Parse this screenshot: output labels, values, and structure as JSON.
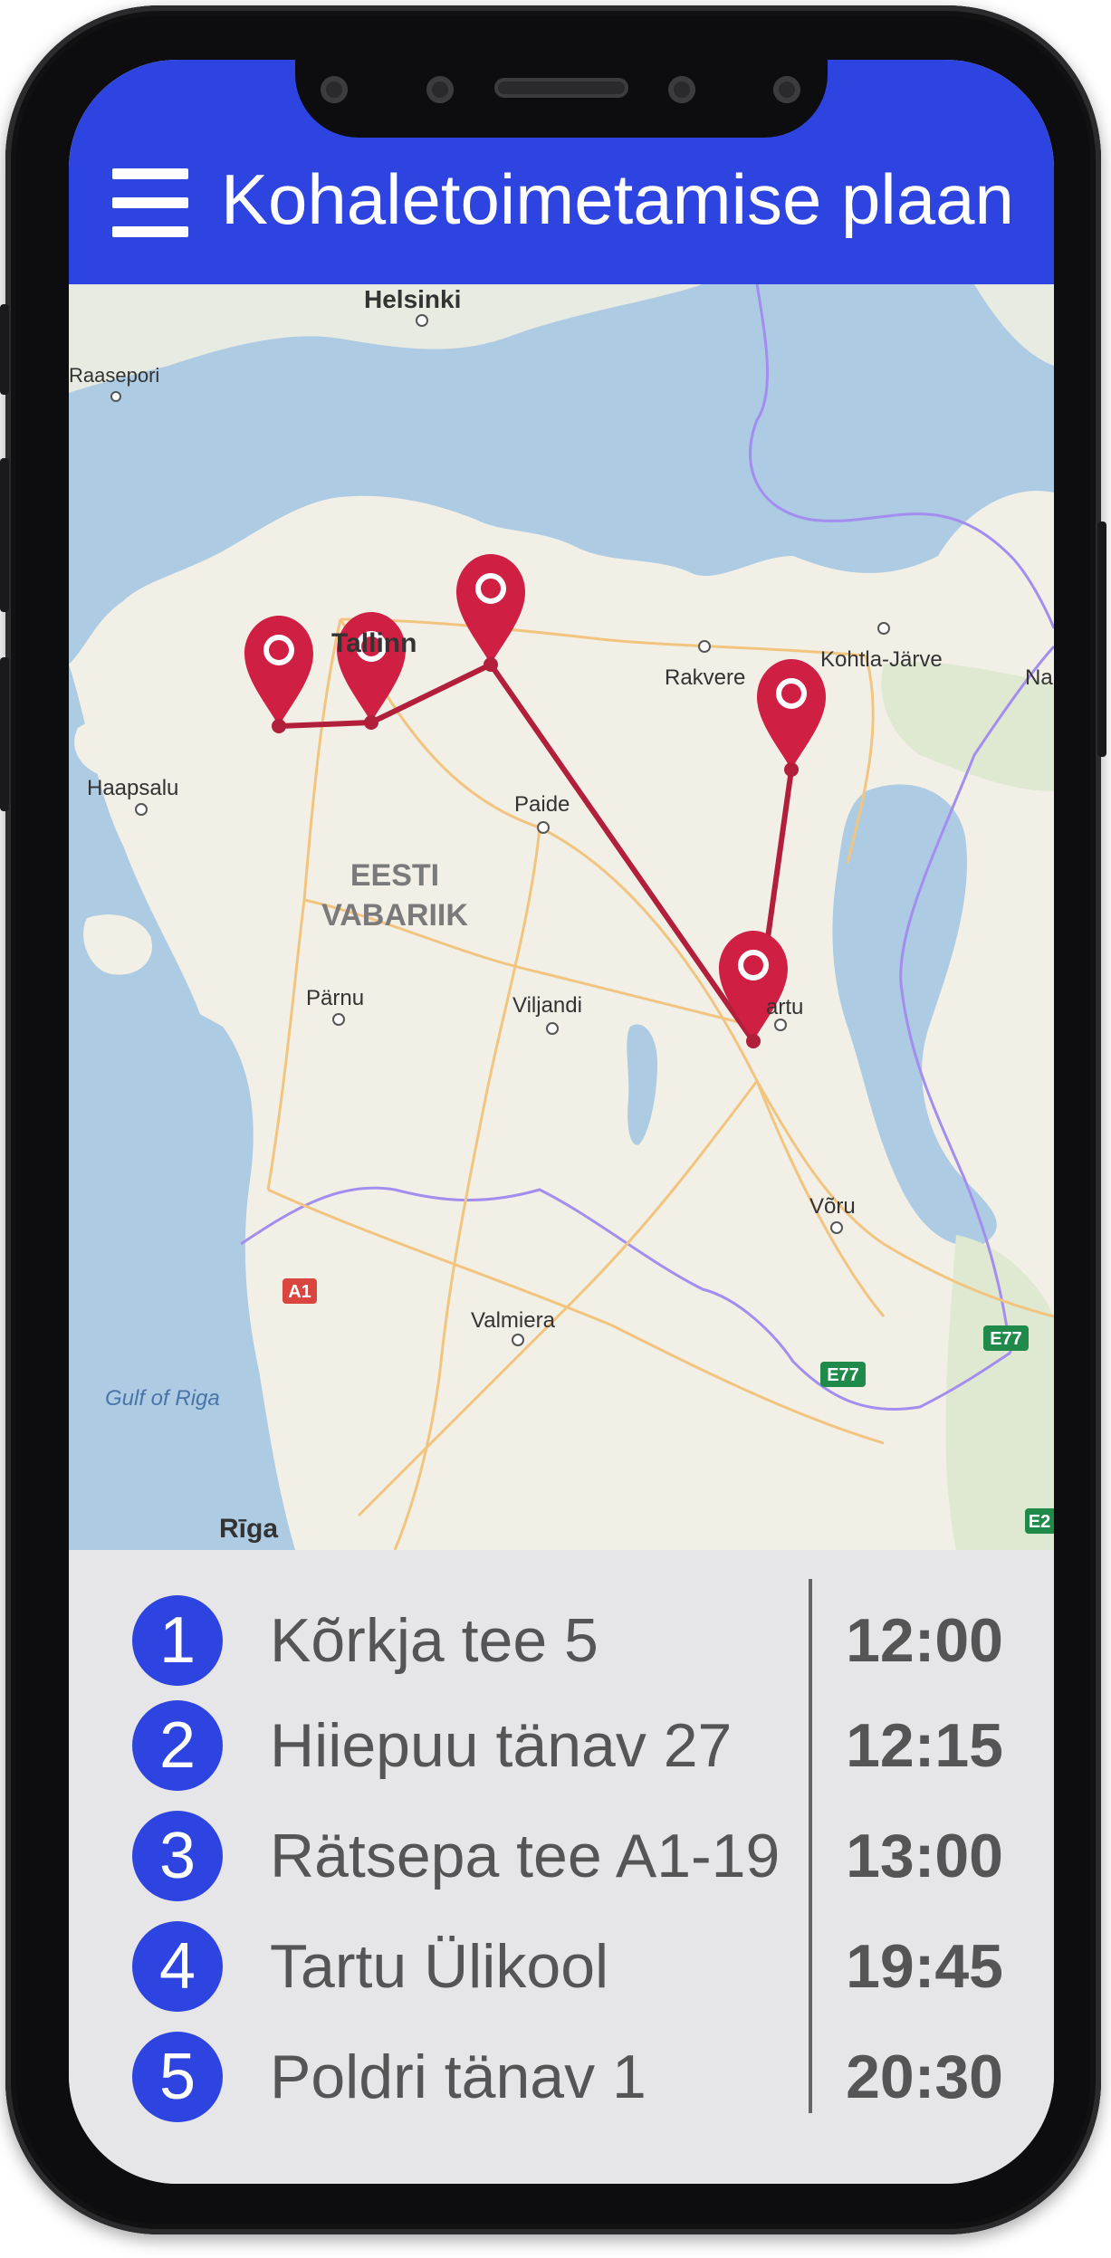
{
  "header": {
    "title": "Kohaletoimetamise plaan",
    "menu_icon": "hamburger-menu-icon",
    "color": "#2d44e0"
  },
  "map": {
    "country_label": [
      "EESTI",
      "VABARIIK"
    ],
    "places": [
      "Helsinki",
      "Raasepori",
      "Tallinn",
      "Rakvere",
      "Kohtla-Järve",
      "Na",
      "Haapsalu",
      "Paide",
      "Pärnu",
      "Viljandi",
      "artu",
      "Võru",
      "Valmiera",
      "Rīga",
      "Gulf of Riga"
    ],
    "road_shields": [
      "A1",
      "E77",
      "E77",
      "E2"
    ],
    "route_color": "#b21f3a",
    "marker_icon": "map-pin-icon"
  },
  "deliveries": [
    {
      "number": "1",
      "address": "Kõrkja tee 5",
      "time": "12:00"
    },
    {
      "number": "2",
      "address": "Hiiepuu tänav 27",
      "time": "12:15"
    },
    {
      "number": "3",
      "address": "Rätsepa tee A1-19",
      "time": "13:00"
    },
    {
      "number": "4",
      "address": "Tartu Ülikool",
      "time": "19:45"
    },
    {
      "number": "5",
      "address": "Poldri tänav 1",
      "time": "20:30"
    }
  ]
}
